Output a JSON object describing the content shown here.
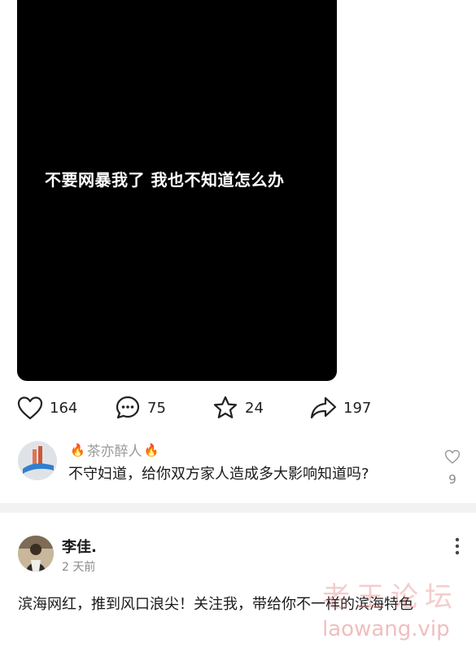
{
  "video": {
    "caption": "不要网暴我了 我也不知道怎么办"
  },
  "actions": {
    "like_count": "164",
    "comment_count": "75",
    "favorite_count": "24",
    "share_count": "197"
  },
  "comment": {
    "author": "茶亦醉人",
    "text": "不守妇道，给你双方家人造成多大影响知道吗?",
    "like_count": "9"
  },
  "post": {
    "author": "李佳.",
    "time": "2 天前",
    "text": "滨海网红，推到风口浪尖！关注我，带给你不一样的滨海特色"
  },
  "watermark": {
    "cn": "老王论坛",
    "en": "laowang.vip"
  },
  "colors": {
    "accent_fire": "#f15a22",
    "divider": "#f2f2f2"
  }
}
